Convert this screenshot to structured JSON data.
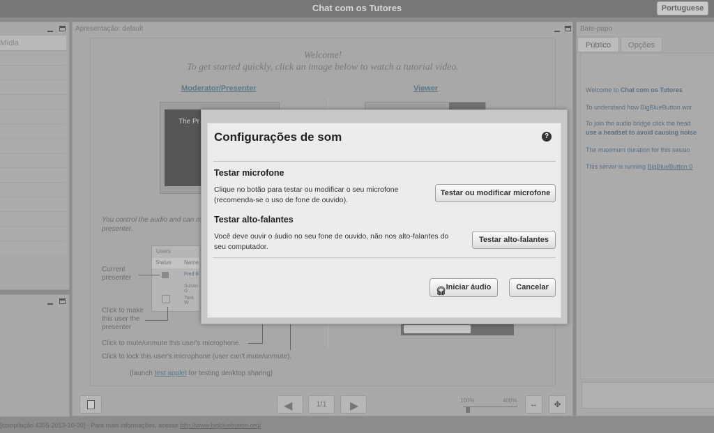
{
  "header": {
    "title": "Chat com os Tutores",
    "language": "Portuguese"
  },
  "left_panel": {
    "media_header": "Mídia"
  },
  "presentation": {
    "title": "Apresentação: default",
    "welcome_line1": "Welcome!",
    "welcome_line2": "To get started quickly, click an image below to watch a tutorial video.",
    "link_moderator": "Moderator/Presenter",
    "link_viewer": "Viewer",
    "thumb_text": "The Pr",
    "audio_note_1": "You control the audio and can m",
    "audio_note_2": "presenter.",
    "users_label": "Users",
    "users_status": "Status",
    "users_name": "Name",
    "user1": "Fred B",
    "user2": "Susan G",
    "user3": "Tara W",
    "current_presenter": "Current presenter",
    "click_make": "Click to make this user the presenter",
    "mute_note": "Click to mute/unmute this user's microphone.",
    "lock_note": "Click to lock this user's microphone (user can't mute/unmute).",
    "launch_prefix": "(launch ",
    "launch_link": "test applet",
    "launch_suffix": " for testing desktop sharing)",
    "page_indicator": "1/1",
    "zoom_min": "100%",
    "zoom_max": "400%"
  },
  "chat": {
    "title": "Bate-papo",
    "tab_public": "Público",
    "tab_options": "Opções",
    "msg1_prefix": "Welcome to ",
    "msg1_bold": "Chat com os Tutores",
    "msg2": "To understand how BigBlueButton wor",
    "msg3": "To join the audio bridge click the head",
    "msg3b": "use a headset to avoid causing noise",
    "msg4": "The maximum duration for this sessio",
    "msg5_prefix": "This server is running ",
    "msg5_link": "BigBlueButton 0"
  },
  "footer": {
    "prefix": "[compilação 4355-2013-10-30] - Para mais informações, acesse ",
    "link": "http://www.bigbluebutton.org/"
  },
  "dialog": {
    "title": "Configurações de som",
    "help": "?",
    "mic_section": "Testar microfone",
    "mic_desc_1": "Clique no botão para testar ou modificar o seu microfone",
    "mic_desc_2": "(recomenda-se o uso de fone de ouvido).",
    "mic_button": "Testar ou modificar microfone",
    "spk_section": "Testar alto-falantes",
    "spk_desc_1": "Você deve ouvir o áudio no seu fone de ouvido, não nos alto-falantes do",
    "spk_desc_2": "seu computador.",
    "spk_button": "Testar alto-falantes",
    "start_button": "Iniciar áudio",
    "cancel_button": "Cancelar"
  }
}
